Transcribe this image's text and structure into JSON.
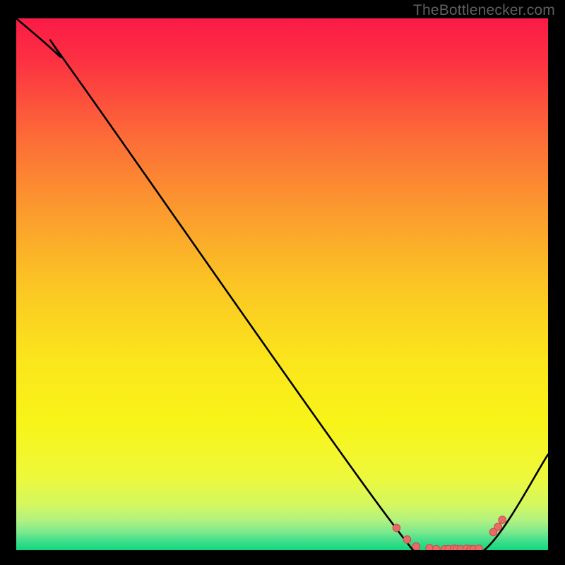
{
  "attribution": "TheBottlenecker.com",
  "colors": {
    "background_black": "#000000",
    "attribution_text": "#5f5f5f",
    "gradient_top": "#fb1a46",
    "gradient_mid": "#f9ee18",
    "gradient_bottom": "#11d77f",
    "curve": "#000000",
    "dot_fill": "#ea6a66",
    "dot_stroke": "#c94c48"
  },
  "chart_data": {
    "type": "line",
    "title": "",
    "xlabel": "",
    "ylabel": "",
    "xlim": [
      0,
      100
    ],
    "ylim": [
      0,
      100
    ],
    "curve": {
      "x": [
        0,
        8,
        12,
        70,
        78,
        88,
        100
      ],
      "y": [
        100,
        93,
        88,
        6,
        0,
        0,
        18
      ]
    },
    "dots": {
      "x": [
        71.5,
        73.5,
        75.2,
        77.7,
        79.0,
        80.6,
        81.3,
        82.3,
        82.8,
        83.6,
        84.7,
        85.4,
        86.0,
        87.0,
        89.7,
        90.6,
        91.4
      ],
      "y": [
        4.2,
        2.0,
        0.7,
        0.4,
        0.2,
        0.2,
        0.2,
        0.3,
        0.2,
        0.2,
        0.3,
        0.2,
        0.2,
        0.3,
        3.4,
        4.4,
        5.7
      ]
    }
  }
}
